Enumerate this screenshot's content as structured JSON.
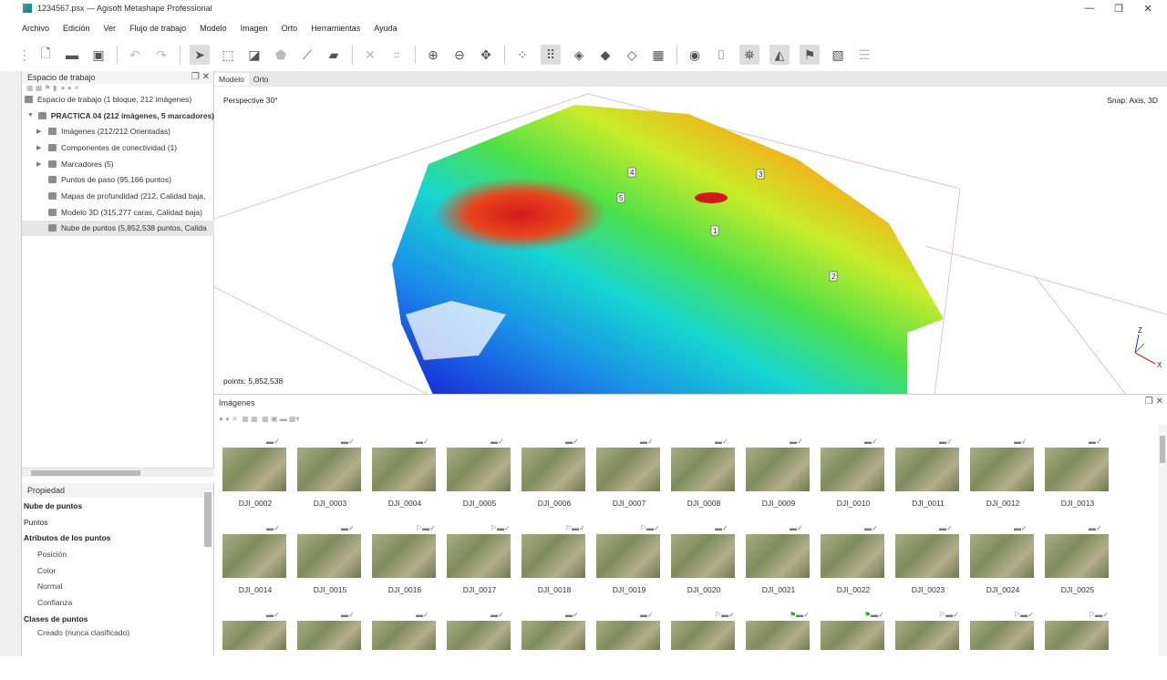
{
  "window": {
    "title": "1234567.psx — Agisoft Metashape Professional",
    "min": "—",
    "max": "❐",
    "close": "✕"
  },
  "menu": [
    "Archivo",
    "Edición",
    "Ver",
    "Flujo de trabajo",
    "Modelo",
    "Imagen",
    "Orto",
    "Herramientas",
    "Ayuda"
  ],
  "workspace": {
    "title": "Espacio de trabajo",
    "items": [
      {
        "label": "Espacio de trabajo (1 bloque, 212 imágenes)"
      },
      {
        "label": "PRACTICA 04 (212 imágenes, 5 marcadores)"
      },
      {
        "label": "Imágenes (212/212 Orientadas)"
      },
      {
        "label": "Componentes de conectividad (1)"
      },
      {
        "label": "Marcadores (5)"
      },
      {
        "label": "Puntos de paso (95,166 puntos)"
      },
      {
        "label": "Mapas de profundidad (212, Calidad baja,"
      },
      {
        "label": "Modelo 3D (315,277 caras, Calidad baja)"
      },
      {
        "label": "Nube de puntos (5,852,538 puntos, Calida"
      }
    ]
  },
  "properties": {
    "title": "Propiedad",
    "rows": [
      {
        "label": "Nube de puntos",
        "bold": true
      },
      {
        "label": "Puntos"
      },
      {
        "label": "Atributos de los puntos",
        "bold": true
      },
      {
        "label": "Posición",
        "indent": true
      },
      {
        "label": "Color",
        "indent": true
      },
      {
        "label": "Normal",
        "indent": true
      },
      {
        "label": "Confianza",
        "indent": true
      },
      {
        "label": "Clases de puntos",
        "bold": true
      },
      {
        "label": "Creado (nunca clasificado)",
        "indent": true
      }
    ]
  },
  "view": {
    "tabs": [
      "Modelo",
      "Orto"
    ],
    "perspective": "Perspective 30°",
    "snap": "Snap: Axis, 3D",
    "points": "points: 5,852,538",
    "markers": [
      "1",
      "2",
      "3",
      "4",
      "5"
    ],
    "axes": {
      "z": "Z",
      "x": "X"
    }
  },
  "images": {
    "title": "Imágenes",
    "row1": [
      "DJI_0002",
      "DJI_0003",
      "DJI_0004",
      "DJI_0005",
      "DJI_0006",
      "DJI_0007",
      "DJI_0008",
      "DJI_0009",
      "DJI_0010",
      "DJI_0011",
      "DJI_0012",
      "DJI_0013"
    ],
    "row2": [
      "DJI_0014",
      "DJI_0015",
      "DJI_0016",
      "DJI_0017",
      "DJI_0018",
      "DJI_0019",
      "DJI_0020",
      "DJI_0021",
      "DJI_0022",
      "DJI_0023",
      "DJI_0024",
      "DJI_0025"
    ]
  },
  "colors": {
    "accent": "#3fa77d",
    "selection": "#e6e6e6"
  }
}
